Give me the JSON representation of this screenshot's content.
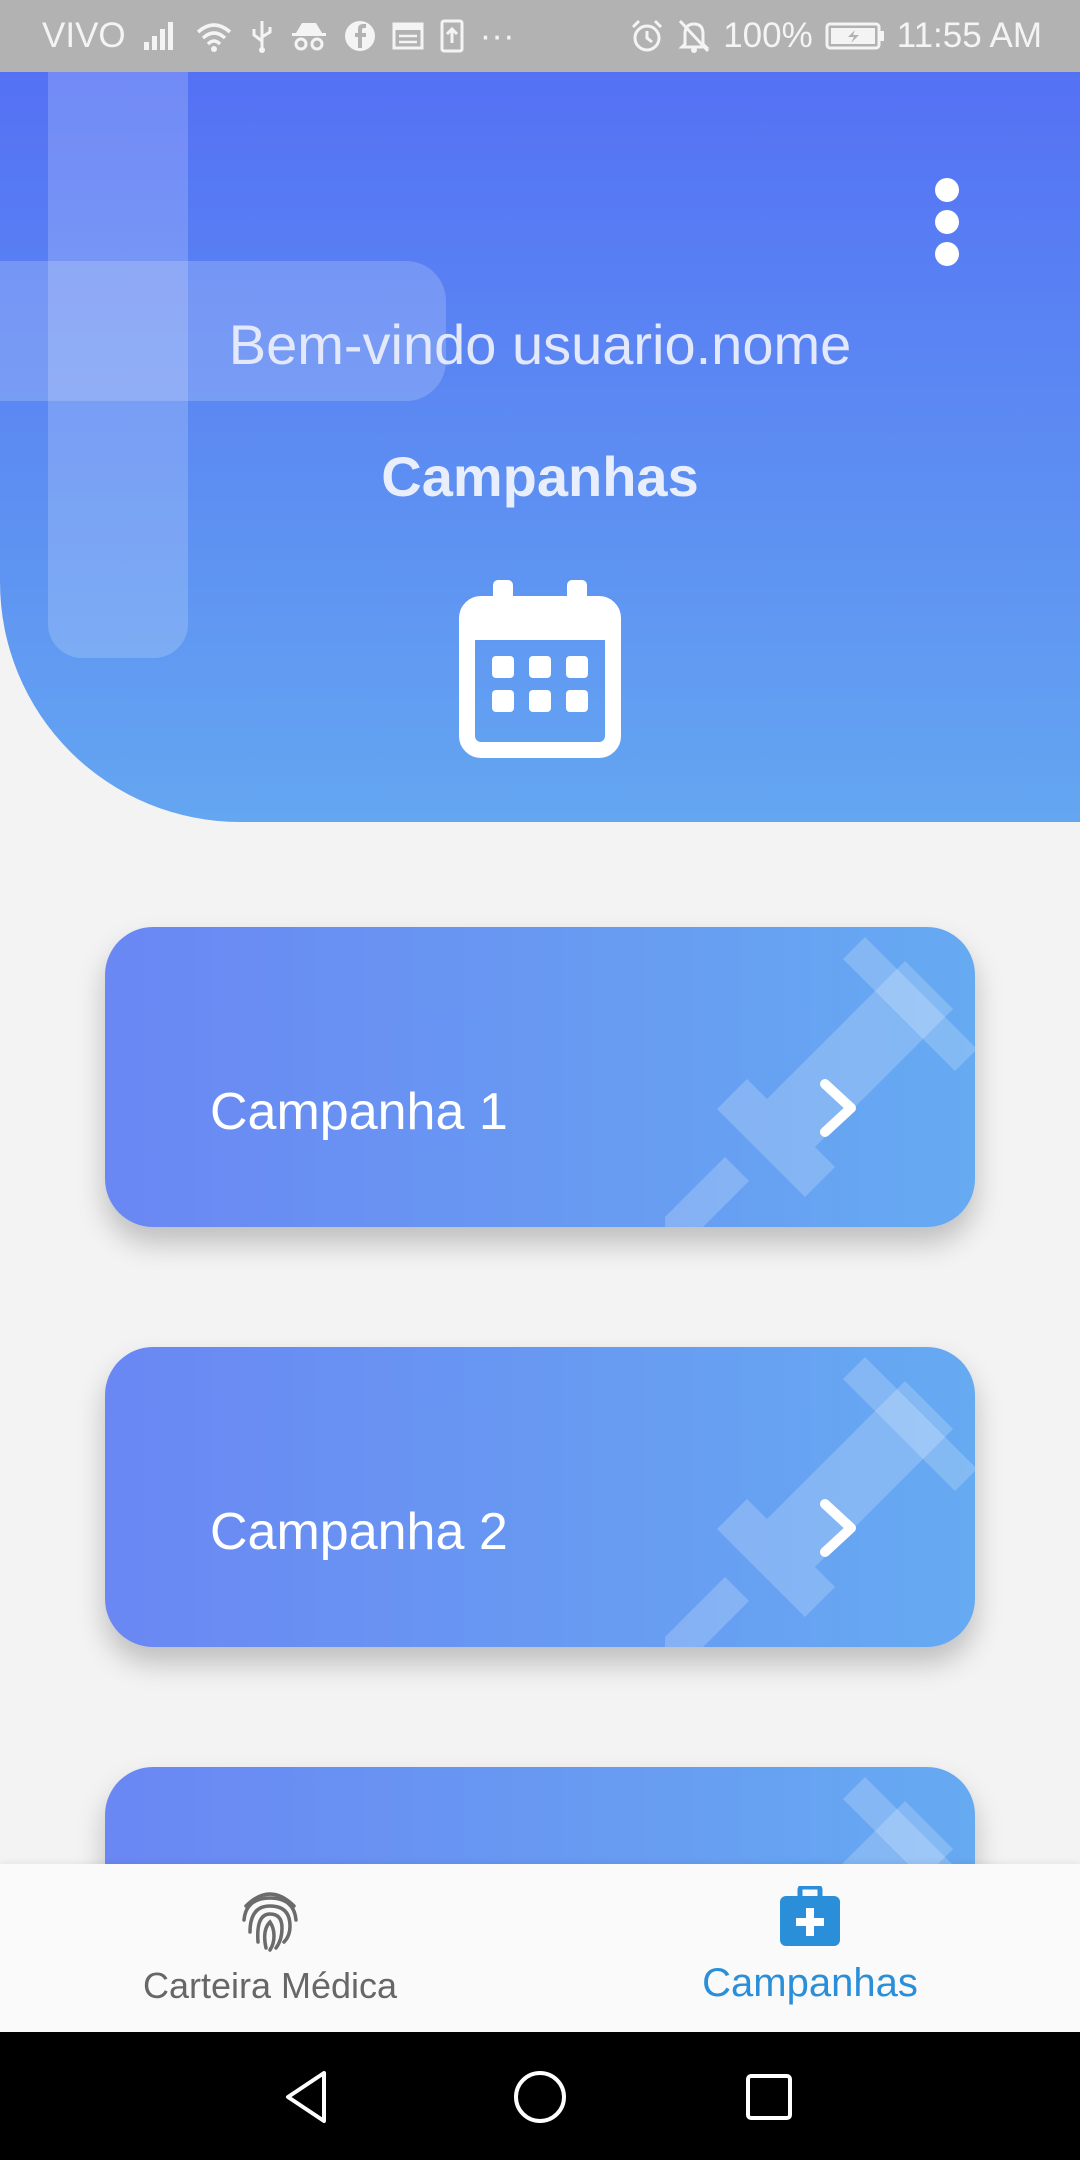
{
  "status_bar": {
    "carrier": "VIVO",
    "battery": "100%",
    "time": "11:55 AM",
    "left_icons": [
      "signal-icon",
      "wifi-icon",
      "usb-icon",
      "incognito-icon",
      "facebook-icon",
      "news-icon",
      "upload-icon",
      "more-dots-icon"
    ],
    "right_icons": [
      "alarm-icon",
      "bell-off-icon",
      "battery-charging-icon"
    ],
    "more": "···"
  },
  "header": {
    "welcome": "Bem-vindo usuario.nome",
    "title": "Campanhas",
    "icon": "calendar-icon",
    "menu_icon": "more-vert-icon"
  },
  "campaigns": [
    {
      "label": "Campanha 1"
    },
    {
      "label": "Campanha 2"
    },
    {
      "label": ""
    }
  ],
  "bottom_nav": {
    "items": [
      {
        "label": "Carteira Médica",
        "icon": "fingerprint-icon",
        "active": false
      },
      {
        "label": "Campanhas",
        "icon": "medical-kit-icon",
        "active": true
      }
    ]
  },
  "colors": {
    "header_top": "#5471f4",
    "header_bottom": "#64a6f1",
    "card_left": "#6a87f3",
    "card_right": "#66aaf2",
    "active_nav": "#2a8fd8",
    "inactive_nav": "#676767",
    "background": "#f3f3f3"
  }
}
